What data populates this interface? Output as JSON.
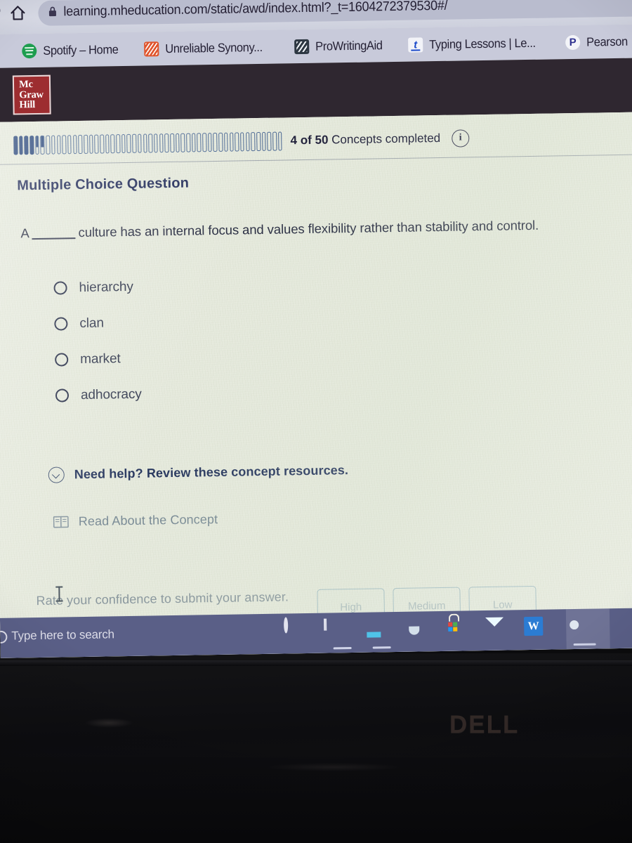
{
  "browser": {
    "home_icon": "home-icon",
    "lock_icon": "lock-icon",
    "url": "learning.mheducation.com/static/awd/index.html?_t=1604272379530#/",
    "bookmarks": [
      {
        "label": "Spotify – Home",
        "icon": "spotify-icon"
      },
      {
        "label": "Unreliable Synony...",
        "icon": "thesaurus-icon"
      },
      {
        "label": "ProWritingAid",
        "icon": "prowritingaid-icon"
      },
      {
        "label": "Typing Lessons | Le...",
        "icon": "typing-icon"
      },
      {
        "label": "Pearson",
        "icon": "pearson-icon"
      }
    ]
  },
  "site_header": {
    "logo_lines": [
      "Mc",
      "Graw",
      "Hill"
    ],
    "logo_color": "#9d2d30"
  },
  "progress": {
    "total_ticks": 50,
    "completed": 4,
    "count_label": "4 of 50",
    "status_label": "Concepts completed",
    "info_icon": "info-icon",
    "info_glyph": "i",
    "fill_color": "#2c4a80",
    "track_color": "#4a6897"
  },
  "question": {
    "type_label": "Multiple Choice Question",
    "text_before": "A",
    "text_after": "culture has an internal focus and values flexibility rather than stability and control.",
    "options": [
      {
        "label": "hierarchy",
        "selected": false
      },
      {
        "label": "clan",
        "selected": false
      },
      {
        "label": "market",
        "selected": false
      },
      {
        "label": "adhocracy",
        "selected": false
      }
    ]
  },
  "help": {
    "toggle_icon": "chevron-down-circle-icon",
    "heading": "Need help? Review these concept resources.",
    "resource_icon": "book-icon",
    "resource_label": "Read About the Concept"
  },
  "confidence": {
    "prompt": "Rate your confidence to submit your answer.",
    "buttons": [
      {
        "label": "High"
      },
      {
        "label": "Medium"
      },
      {
        "label": "Low"
      }
    ]
  },
  "taskbar": {
    "search_icon": "search-circle-icon",
    "search_placeholder": "Type here to search",
    "icons": [
      {
        "name": "cortana-icon"
      },
      {
        "name": "task-view-icon"
      },
      {
        "name": "file-explorer-icon"
      },
      {
        "name": "edge-icon"
      },
      {
        "name": "microsoft-store-icon"
      },
      {
        "name": "mail-icon"
      },
      {
        "name": "word-icon"
      },
      {
        "name": "chrome-icon"
      }
    ]
  },
  "device": {
    "brand": "DELL"
  }
}
